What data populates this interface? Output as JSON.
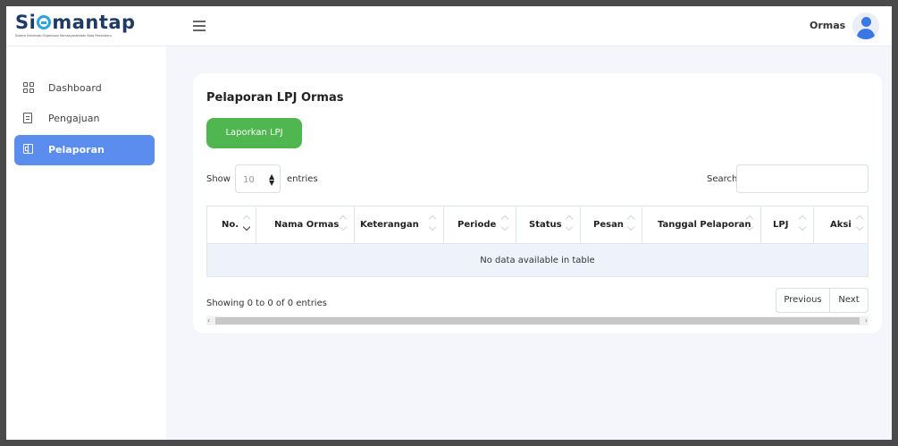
{
  "brand": {
    "logo_text_a": "Si",
    "logo_text_b": "mantap",
    "logo_subtitle": "Sistem Informasi Organisasi Kemasyarakatan Kota Pekanbaru"
  },
  "header": {
    "user_name": "Ormas"
  },
  "sidebar": {
    "items": [
      {
        "label": "Dashboard",
        "icon": "grid-icon",
        "active": false
      },
      {
        "label": "Pengajuan",
        "icon": "document-icon",
        "active": false
      },
      {
        "label": "Pelaporan",
        "icon": "book-icon",
        "active": true
      }
    ]
  },
  "main": {
    "title": "Pelaporan LPJ Ormas",
    "report_button": "Laporkan LPJ",
    "show_label": "Show",
    "page_length": "10",
    "entries_label": "entries",
    "search_label": "Search:",
    "search_value": "",
    "columns": [
      "No.",
      "Nama Ormas",
      "Keterangan",
      "Periode",
      "Status",
      "Pesan",
      "Tanggal Pelaporan",
      "LPJ",
      "Aksi"
    ],
    "empty_message": "No data available in table",
    "info": "Showing 0 to 0 of 0 entries",
    "previous": "Previous",
    "next": "Next"
  },
  "colors": {
    "accent": "#5b8def",
    "button_green": "#4fb650",
    "logo_dark": "#1f3a63",
    "logo_ring": "#2ba4e0"
  }
}
